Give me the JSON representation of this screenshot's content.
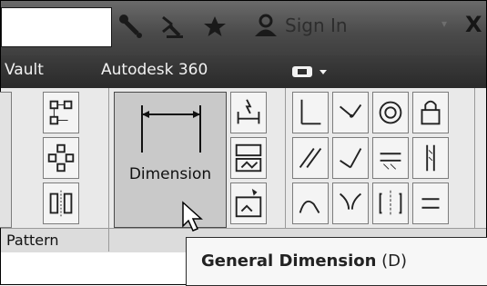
{
  "titlebar": {
    "sign_in_label": "Sign In",
    "icons": [
      "wrench-search-icon",
      "satellite-icon",
      "star-icon",
      "user-icon"
    ]
  },
  "menubar": {
    "items": [
      "Vault",
      "Autodesk 360"
    ]
  },
  "ribbon": {
    "dimension_label": "Dimension",
    "pattern_panel_title": "Pattern"
  },
  "tooltip": {
    "title": "General Dimension",
    "shortcut": "(D)"
  },
  "colors": {
    "titlebar": "#4a4a4a",
    "menubar": "#2f2f2f",
    "ribbon": "#e9e9e9",
    "active_button": "#c9c9c9"
  }
}
